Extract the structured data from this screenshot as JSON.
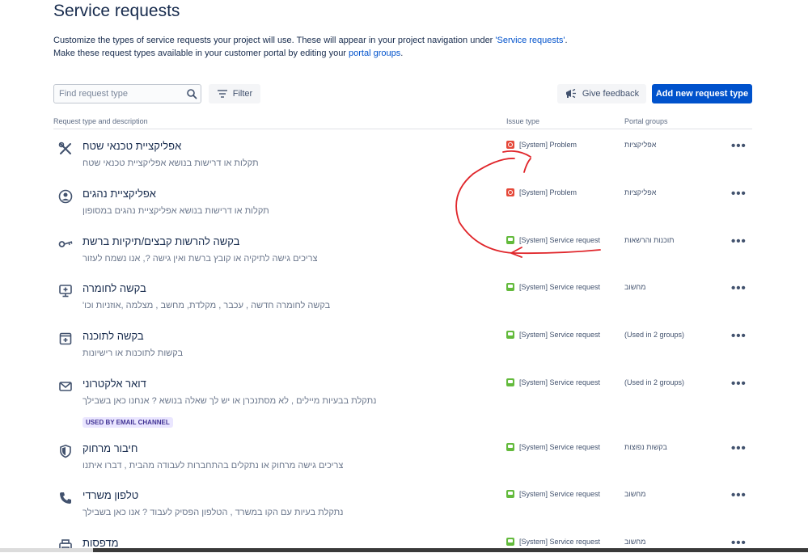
{
  "header": {
    "title": "Service requests",
    "desc1_prefix": "Customize the types of service requests your project will use. These will appear in your project navigation under ",
    "desc1_link": "'Service requests'",
    "desc1_suffix": ".",
    "desc2_prefix": "Make these request types available in your customer portal by editing your ",
    "desc2_link": "portal groups",
    "desc2_suffix": "."
  },
  "toolbar": {
    "search_placeholder": "Find request type",
    "filter_label": "Filter",
    "feedback_label": "Give feedback",
    "add_label": "Add new request type"
  },
  "table": {
    "columns": {
      "type": "Request type and description",
      "issue": "Issue type",
      "portal": "Portal groups"
    },
    "rows": [
      {
        "icon": "tools-icon",
        "name": "אפליקציית טכנאי שטח",
        "desc": "תקלות או דרישות בנושא אפליקציית טכנאי שטח",
        "issue_kind": "problem",
        "issue": "[System] Problem",
        "portal": "אפליקציות",
        "more": "•••"
      },
      {
        "icon": "user-circle-icon",
        "name": "אפליקציית נהגים",
        "desc": "תקלות או דרישות בנושא אפליקציית נהגים במסופון",
        "issue_kind": "problem",
        "issue": "[System] Problem",
        "portal": "אפליקציות",
        "more": "•••"
      },
      {
        "icon": "key-icon",
        "name": "בקשה להרשות קבצים/תיקיות ברשת",
        "desc": "צריכים גישה לתיקיה או קובץ ברשת ואין גישה ?, אנו נשמח לעזור",
        "issue_kind": "service",
        "issue": "[System] Service request",
        "portal": "תוכנות והרשאות",
        "more": "•••"
      },
      {
        "icon": "monitor-plus-icon",
        "name": "בקשה לחומרה",
        "desc": "בקשה לחומרה חדשה , עכבר , מקלדת, מחשב , מצלמה ,אוזניות וכו'",
        "issue_kind": "service",
        "issue": "[System] Service request",
        "portal": "מחשוב",
        "more": "•••"
      },
      {
        "icon": "window-plus-icon",
        "name": "בקשה לתוכנה",
        "desc": "בקשות לתוכנות או רישיונות",
        "issue_kind": "service",
        "issue": "[System] Service request",
        "portal": "(Used in 2 groups)",
        "more": "•••"
      },
      {
        "icon": "envelope-icon",
        "name": "דואר אלקטרוני",
        "desc": "נתקלת בבעיות מיילים , לא מסתנכרן או יש לך שאלה בנושא ? אנחנו כאן בשבילך",
        "issue_kind": "service",
        "issue": "[System] Service request",
        "portal": "(Used in 2 groups)",
        "badge": "USED BY EMAIL CHANNEL",
        "more": "•••"
      },
      {
        "icon": "shield-icon",
        "name": "חיבור מרחוק",
        "desc": "צריכים גישה מרחוק או נתקלים בהתחברות לעבודה מהבית , דברו איתנו",
        "issue_kind": "service",
        "issue": "[System] Service request",
        "portal": "בקשות נפוצות",
        "more": "•••"
      },
      {
        "icon": "phone-icon",
        "name": "טלפון משרדי",
        "desc": "נתקלת בעיות עם הקו במשרד , הטלפון הפסיק לעבוד ? אנו כאן בשבילך",
        "issue_kind": "service",
        "issue": "[System] Service request",
        "portal": "מחשוב",
        "more": "•••"
      },
      {
        "icon": "printer-icon",
        "name": "מדפסות",
        "desc": "",
        "issue_kind": "service",
        "issue": "[System] Service request",
        "portal": "מחשוב",
        "more": "•••"
      }
    ]
  },
  "colors": {
    "primary": "#0052cc",
    "problem": "#e5493a",
    "service": "#63ba3c",
    "annotation": "#e0262b"
  }
}
